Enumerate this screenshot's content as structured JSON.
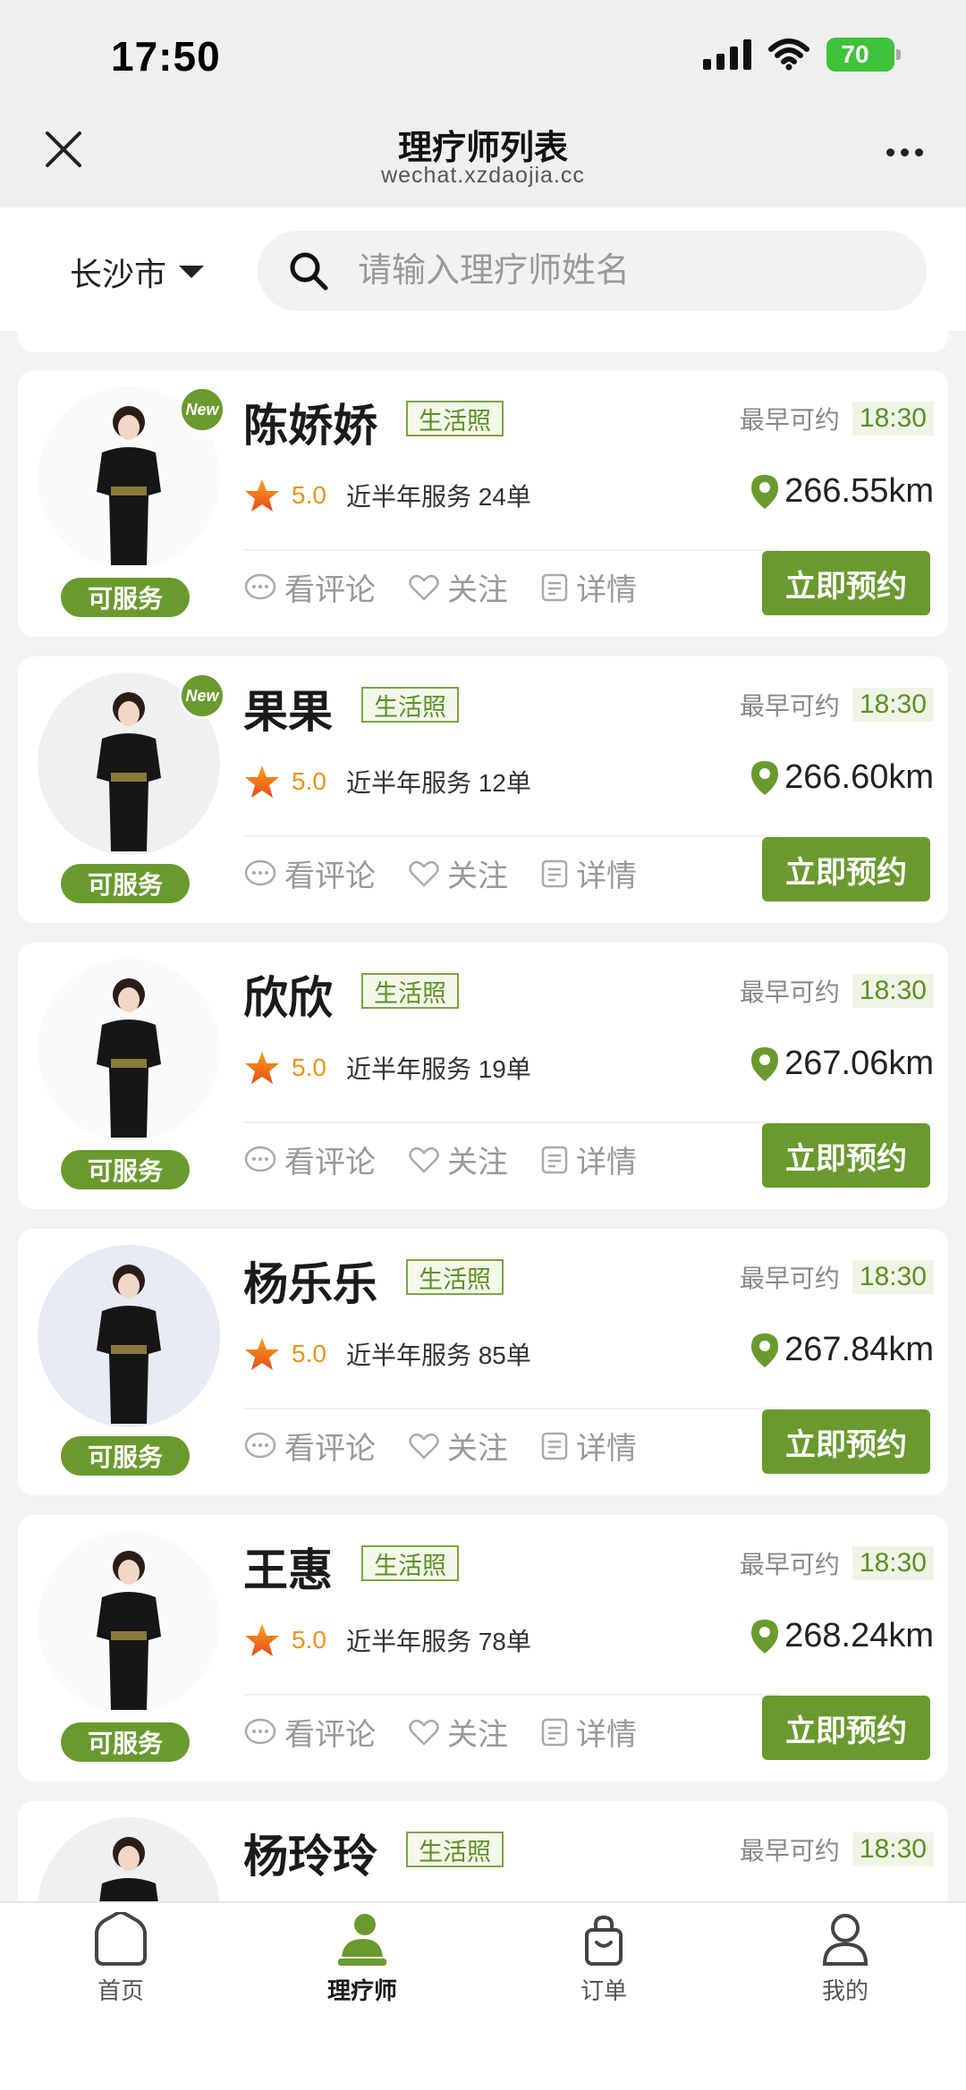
{
  "status_bar": {
    "time": "17:50",
    "battery": "70"
  },
  "header": {
    "title": "理疗师列表",
    "subtitle": "wechat.xzdaojia.cc"
  },
  "search": {
    "city": "长沙市",
    "placeholder": "请输入理疗师姓名"
  },
  "labels": {
    "life_photo": "生活照",
    "earliest": "最早可约",
    "comments": "看评论",
    "follow": "关注",
    "details": "详情",
    "book": "立即预约",
    "serviceable": "可服务",
    "new_badge": "New"
  },
  "therapists": [
    {
      "name": "陈娇娇",
      "is_new": true,
      "time": "18:30",
      "rating": "5.0",
      "service": "近半年服务 24单",
      "distance": "266.55km",
      "avatar_bg": "white"
    },
    {
      "name": "果果",
      "is_new": true,
      "time": "18:30",
      "rating": "5.0",
      "service": "近半年服务 12单",
      "distance": "266.60km",
      "avatar_bg": "light"
    },
    {
      "name": "欣欣",
      "is_new": false,
      "time": "18:30",
      "rating": "5.0",
      "service": "近半年服务 19单",
      "distance": "267.06km",
      "avatar_bg": "white"
    },
    {
      "name": "杨乐乐",
      "is_new": false,
      "time": "18:30",
      "rating": "5.0",
      "service": "近半年服务 85单",
      "distance": "267.84km",
      "avatar_bg": "tinted"
    },
    {
      "name": "王惠",
      "is_new": false,
      "time": "18:30",
      "rating": "5.0",
      "service": "近半年服务 78单",
      "distance": "268.24km",
      "avatar_bg": "white"
    },
    {
      "name": "杨玲玲",
      "is_new": false,
      "time": "18:30",
      "rating": "",
      "service": "",
      "distance": "",
      "avatar_bg": "light"
    }
  ],
  "tabbar": [
    {
      "label": "首页",
      "icon": "home-icon",
      "active": false
    },
    {
      "label": "理疗师",
      "icon": "therapist-icon",
      "active": true
    },
    {
      "label": "订单",
      "icon": "bag-icon",
      "active": false
    },
    {
      "label": "我的",
      "icon": "user-icon",
      "active": false
    }
  ],
  "colors": {
    "accent": "#6a9a2e",
    "star": "#f06b1e",
    "rating": "#e8941c"
  }
}
